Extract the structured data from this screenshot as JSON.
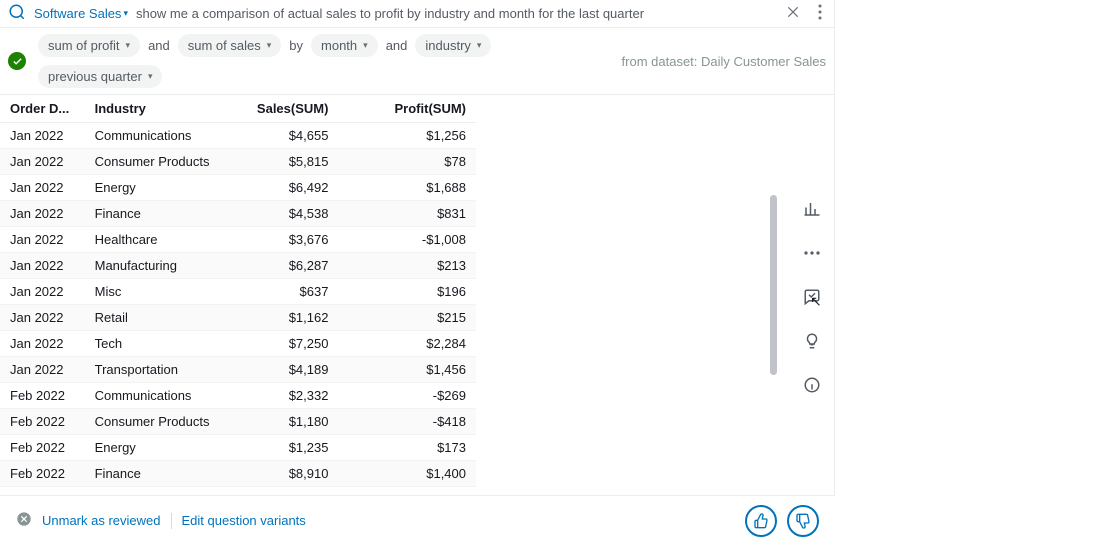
{
  "query": {
    "data_source": "Software Sales",
    "prefix": "show me a comparison of ",
    "kw1": "actual sales",
    "mid1": " to ",
    "kw2": "profit",
    "mid2": " by ",
    "kw3": "industry",
    "mid3": " and ",
    "kw4": "month",
    "mid4": " for the last ",
    "kw5": "quarter"
  },
  "interp": {
    "chip1": "sum of profit",
    "conn1": "and",
    "chip2": "sum of sales",
    "conn2": "by",
    "chip3": "month",
    "conn3": "and",
    "chip4": "industry",
    "chip5": "previous quarter"
  },
  "dataset_info": "from dataset: Daily Customer Sales",
  "table": {
    "headers": {
      "order_date": "Order D...",
      "industry": "Industry",
      "sales": "Sales(SUM)",
      "profit": "Profit(SUM)"
    },
    "rows": [
      {
        "d": "Jan 2022",
        "i": "Communications",
        "s": "$4,655",
        "p": "$1,256"
      },
      {
        "d": "Jan 2022",
        "i": "Consumer Products",
        "s": "$5,815",
        "p": "$78"
      },
      {
        "d": "Jan 2022",
        "i": "Energy",
        "s": "$6,492",
        "p": "$1,688"
      },
      {
        "d": "Jan 2022",
        "i": "Finance",
        "s": "$4,538",
        "p": "$831"
      },
      {
        "d": "Jan 2022",
        "i": "Healthcare",
        "s": "$3,676",
        "p": "-$1,008"
      },
      {
        "d": "Jan 2022",
        "i": "Manufacturing",
        "s": "$6,287",
        "p": "$213"
      },
      {
        "d": "Jan 2022",
        "i": "Misc",
        "s": "$637",
        "p": "$196"
      },
      {
        "d": "Jan 2022",
        "i": "Retail",
        "s": "$1,162",
        "p": "$215"
      },
      {
        "d": "Jan 2022",
        "i": "Tech",
        "s": "$7,250",
        "p": "$2,284"
      },
      {
        "d": "Jan 2022",
        "i": "Transportation",
        "s": "$4,189",
        "p": "$1,456"
      },
      {
        "d": "Feb 2022",
        "i": "Communications",
        "s": "$2,332",
        "p": "-$269"
      },
      {
        "d": "Feb 2022",
        "i": "Consumer Products",
        "s": "$1,180",
        "p": "-$418"
      },
      {
        "d": "Feb 2022",
        "i": "Energy",
        "s": "$1,235",
        "p": "$173"
      },
      {
        "d": "Feb 2022",
        "i": "Finance",
        "s": "$8,910",
        "p": "$1,400"
      }
    ]
  },
  "footer": {
    "unmark": "Unmark as reviewed",
    "edit": "Edit question variants"
  }
}
